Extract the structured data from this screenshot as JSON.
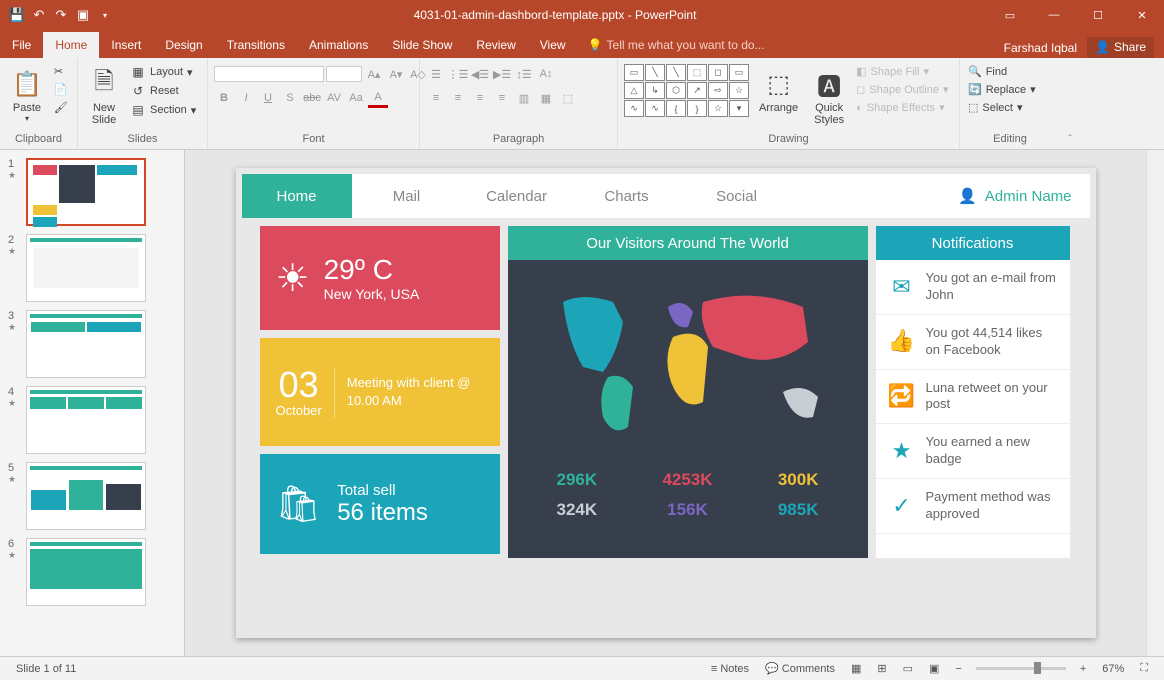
{
  "app": {
    "title": "4031-01-admin-dashbord-template.pptx - PowerPoint"
  },
  "tabs": {
    "file": "File",
    "home": "Home",
    "insert": "Insert",
    "design": "Design",
    "transitions": "Transitions",
    "animations": "Animations",
    "slideshow": "Slide Show",
    "review": "Review",
    "view": "View",
    "tellme": "Tell me what you want to do...",
    "user": "Farshad Iqbal",
    "share": "Share"
  },
  "ribbon": {
    "clipboard": {
      "label": "Clipboard",
      "paste": "Paste",
      "cut": "Cut",
      "copy": "Copy",
      "painter": "Format Painter"
    },
    "slides": {
      "label": "Slides",
      "new": "New\nSlide",
      "layout": "Layout",
      "reset": "Reset",
      "section": "Section"
    },
    "font": {
      "label": "Font",
      "name": "",
      "size": ""
    },
    "paragraph": {
      "label": "Paragraph"
    },
    "drawing": {
      "label": "Drawing",
      "arrange": "Arrange",
      "quickstyles": "Quick\nStyles",
      "fill": "Shape Fill",
      "outline": "Shape Outline",
      "effects": "Shape Effects"
    },
    "editing": {
      "label": "Editing",
      "find": "Find",
      "replace": "Replace",
      "select": "Select"
    }
  },
  "thumbs": {
    "count": 11
  },
  "slide": {
    "nav": {
      "home": "Home",
      "mail": "Mail",
      "calendar": "Calendar",
      "charts": "Charts",
      "social": "Social",
      "admin": "Admin Name"
    },
    "weather": {
      "temp": "29º C",
      "loc": "New York, USA"
    },
    "meeting": {
      "day": "03",
      "month": "October",
      "text": "Meeting with client @ 10.00 AM"
    },
    "sales": {
      "label": "Total sell",
      "value": "56 items"
    },
    "map": {
      "title": "Our Visitors Around The World",
      "stats": [
        {
          "v": "296K",
          "c": "#2FB19A"
        },
        {
          "v": "4253K",
          "c": "#DC4A5E"
        },
        {
          "v": "300K",
          "c": "#EFC238"
        },
        {
          "v": "324K",
          "c": "#C9CDD4"
        },
        {
          "v": "156K",
          "c": "#7C66C4"
        },
        {
          "v": "985K",
          "c": "#1CA5B8"
        }
      ]
    },
    "notif": {
      "title": "Notifications",
      "items": [
        {
          "icon": "✉",
          "text": "You got an e-mail from John"
        },
        {
          "icon": "👍",
          "text": "You got 44,514 likes on Facebook"
        },
        {
          "icon": "🔁",
          "text": "Luna retweet on your post"
        },
        {
          "icon": "★",
          "text": "You earned a new badge"
        },
        {
          "icon": "✓",
          "text": "Payment method was approved"
        }
      ]
    }
  },
  "status": {
    "slide": "Slide 1 of 11",
    "notes": "Notes",
    "comments": "Comments",
    "zoom": "67%"
  }
}
